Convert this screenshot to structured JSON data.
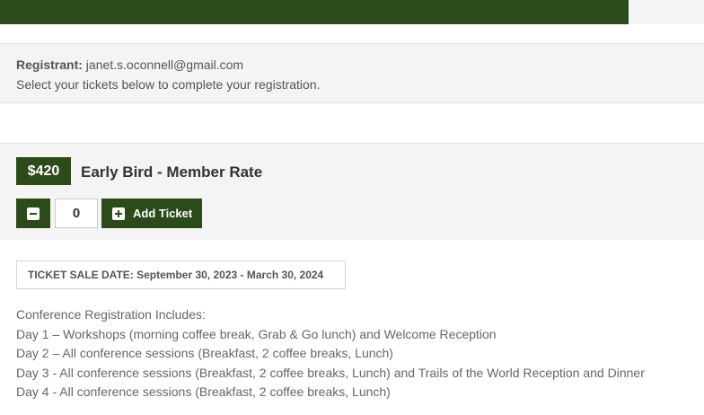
{
  "progress": {
    "fraction": 0.893,
    "color": "#2c4a1a"
  },
  "registrant": {
    "label": "Registrant:",
    "email": "janet.s.oconnell@gmail.com",
    "instructions": "Select your tickets below to complete your registration."
  },
  "ticket": {
    "price": "$420",
    "name": "Early Bird - Member Rate",
    "quantity": "0",
    "add_label": "Add Ticket",
    "sale_date": "TICKET SALE DATE: September 30, 2023 - March 30, 2024",
    "includes_title": "Conference Registration Includes:",
    "includes": [
      "Day 1 – Workshops (morning coffee break, Grab & Go lunch) and Welcome Reception",
      "Day 2 – All conference sessions (Breakfast, 2 coffee breaks, Lunch)",
      "Day 3 - All conference sessions (Breakfast, 2 coffee breaks, Lunch) and Trails of the World Reception and Dinner",
      "Day 4 - All conference sessions (Breakfast, 2 coffee breaks, Lunch)"
    ]
  },
  "colors": {
    "accent": "#2c4a1a",
    "panel": "#f4f4f4",
    "text": "#555555"
  }
}
